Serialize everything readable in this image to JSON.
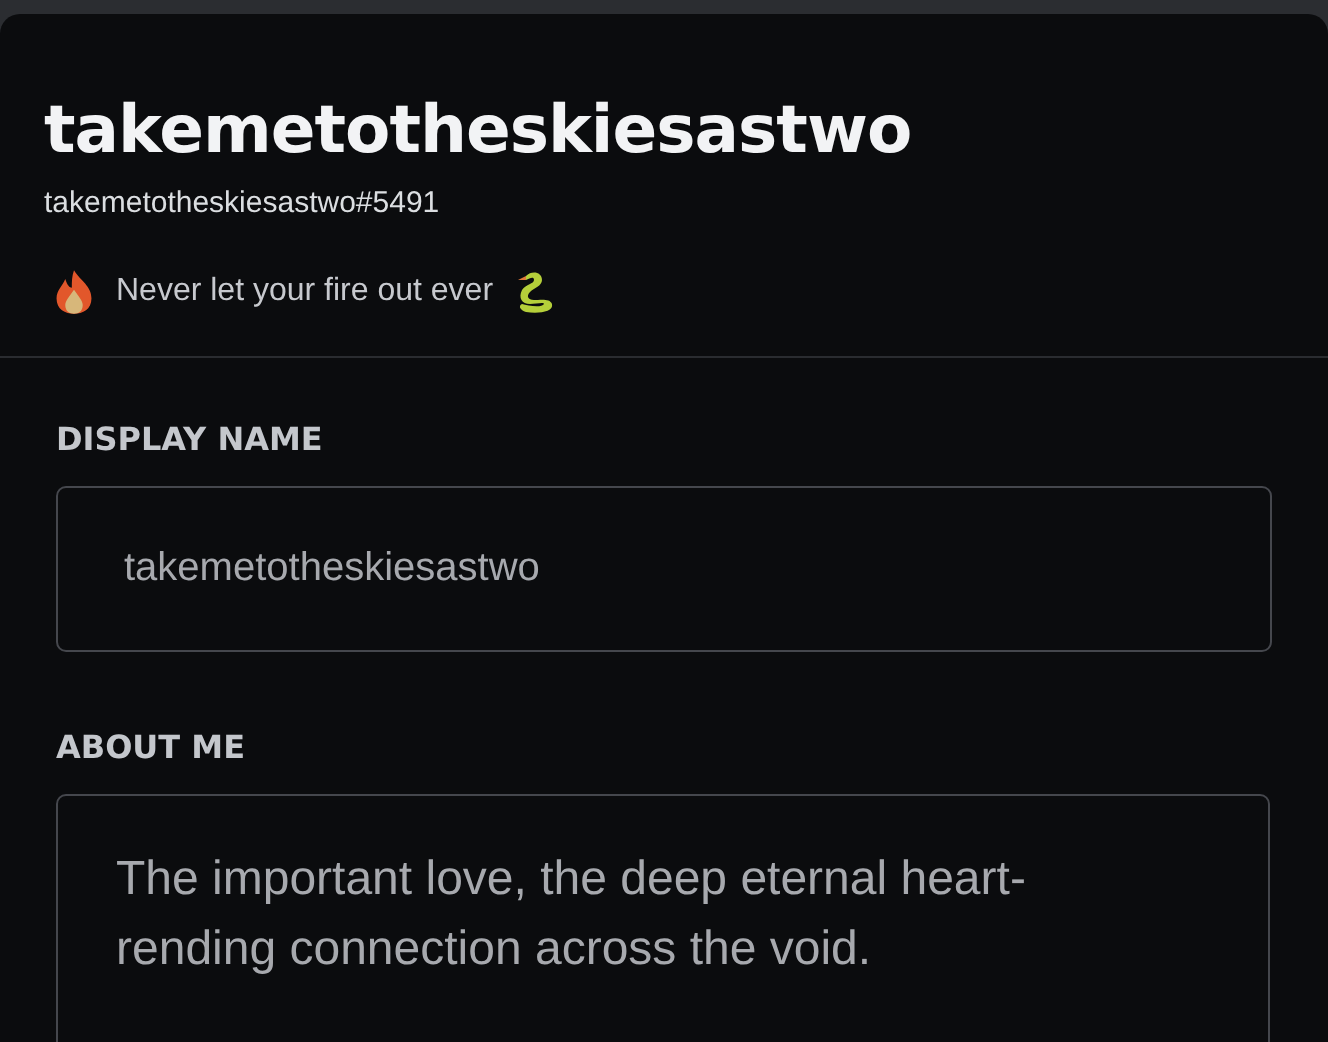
{
  "profile": {
    "display_name": "takemetotheskiesastwo",
    "tag": "takemetotheskiesastwo#5491",
    "status": "Never let your fire out ever"
  },
  "fields": [
    {
      "label": "DISPLAY NAME",
      "kind": "input",
      "value": "takemetotheskiesastwo"
    },
    {
      "label": "ABOUT ME",
      "kind": "textarea",
      "value": "The important love, the deep eternal heart-rending connection across the void."
    }
  ]
}
